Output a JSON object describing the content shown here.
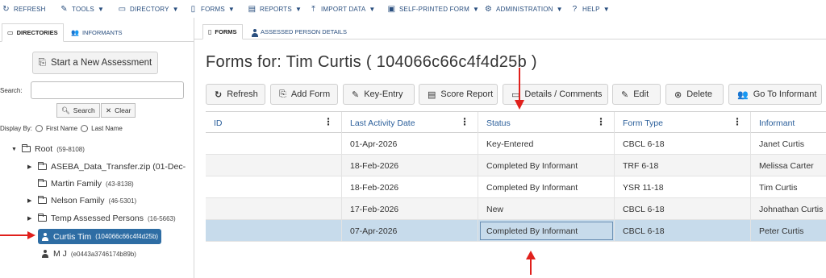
{
  "menu": [
    {
      "label": "REFRESH",
      "icon": "refresh-icon",
      "caret": false
    },
    {
      "label": "TOOLS",
      "icon": "wrench-icon",
      "caret": true
    },
    {
      "label": "DIRECTORY",
      "icon": "folder-icon",
      "caret": true
    },
    {
      "label": "FORMS",
      "icon": "document-icon",
      "caret": true
    },
    {
      "label": "REPORTS",
      "icon": "report-icon",
      "caret": true
    },
    {
      "label": "IMPORT DATA",
      "icon": "upload-icon",
      "caret": true
    },
    {
      "label": "SELF-PRINTED FORM",
      "icon": "printer-icon",
      "caret": true
    },
    {
      "label": "ADMINISTRATION",
      "icon": "gear-icon",
      "caret": true
    },
    {
      "label": "HELP",
      "icon": "help-icon",
      "caret": true
    }
  ],
  "left": {
    "tabs": {
      "directories": "DIRECTORIES",
      "informants": "INFORMANTS"
    },
    "new_assessment": "Start a New Assessment",
    "search_label": "Search:",
    "search_value": "",
    "search_button": "Search",
    "clear_button": "Clear",
    "display_by": "Display By:",
    "first_name": "First Name",
    "last_name": "Last Name",
    "tree": {
      "root": {
        "label": "Root",
        "count": "(59-8108)"
      },
      "aseba": {
        "label": "ASEBA_Data_Transfer.zip (01-Dec-"
      },
      "martin": {
        "label": "Martin Family",
        "count": "(43-8138)"
      },
      "nelson": {
        "label": "Nelson Family",
        "count": "(46-5301)"
      },
      "temp": {
        "label": "Temp Assessed Persons",
        "count": "(16-5663)"
      },
      "curtis": {
        "label": "Curtis Tim",
        "count": "(104066c66c4f4d25b)"
      },
      "mj": {
        "label": "M J",
        "count": "(e0443a3746174b89b)"
      }
    }
  },
  "right": {
    "tabs": {
      "forms": "FORMS",
      "details": "ASSESSED PERSON DETAILS"
    },
    "title": "Forms for:  Tim Curtis  ( 104066c66c4f4d25b )",
    "toolbar": {
      "refresh": "Refresh",
      "add_form": "Add Form",
      "key_entry": "Key-Entry",
      "score_report": "Score Report",
      "details": "Details / Comments",
      "edit": "Edit",
      "delete": "Delete",
      "go_to_informant": "Go To Informant"
    },
    "columns": [
      "ID",
      "Last Activity Date",
      "Status",
      "Form Type",
      "Informant"
    ],
    "rows": [
      {
        "id": "",
        "date": "01-Apr-2026",
        "status": "Key-Entered",
        "form": "CBCL 6-18",
        "informant": "Janet Curtis"
      },
      {
        "id": "",
        "date": "18-Feb-2026",
        "status": "Completed By Informant",
        "form": "TRF 6-18",
        "informant": "Melissa Carter"
      },
      {
        "id": "",
        "date": "18-Feb-2026",
        "status": "Completed By Informant",
        "form": "YSR 11-18",
        "informant": "Tim Curtis"
      },
      {
        "id": "",
        "date": "17-Feb-2026",
        "status": "New",
        "form": "CBCL 6-18",
        "informant": "Johnathan Curtis"
      },
      {
        "id": "",
        "date": "07-Apr-2026",
        "status": "Completed By Informant",
        "form": "CBCL 6-18",
        "informant": "Peter Curtis"
      }
    ]
  },
  "colors": {
    "accent": "#2e6da4",
    "link": "#2a5e9a",
    "selected_row": "#c7dbeb",
    "annotation": "#e0201c"
  }
}
